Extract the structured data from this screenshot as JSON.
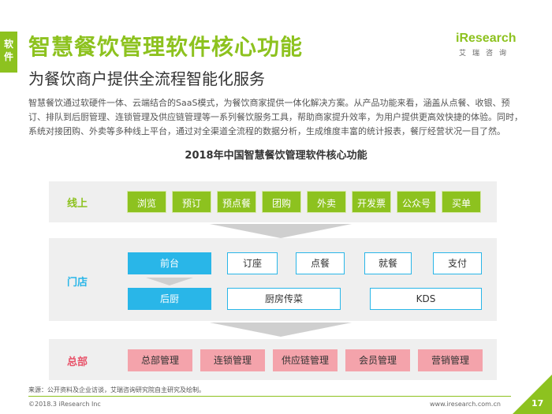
{
  "side_tab": [
    "软",
    "件"
  ],
  "title": "智慧餐饮管理软件核心功能",
  "subtitle": "为餐饮商户提供全流程智能化服务",
  "logo": {
    "word": "iResearch",
    "cn": "艾瑞咨询"
  },
  "intro": "智慧餐饮通过软硬件一体、云端结合的SaaS模式，为餐饮商家提供一体化解决方案。从产品功能来看，涵盖从点餐、收银、预订、排队到后厨管理、连锁管理及供应链管理等一系列餐饮服务工具，帮助商家提升效率，为用户提供更高效快捷的体验。同时，系统对接团购、外卖等多种线上平台，通过对全渠道全流程的数据分析，生成维度丰富的统计报表，餐厅经营状况一目了然。",
  "diagram": {
    "title": "2018年中国智慧餐饮管理软件核心功能",
    "online": {
      "label": "线上",
      "items": [
        "浏览",
        "预订",
        "预点餐",
        "团购",
        "外卖",
        "开发票",
        "公众号",
        "买单"
      ]
    },
    "store": {
      "label": "门店",
      "front": "前台",
      "front_items": [
        "订座",
        "点餐",
        "就餐",
        "支付"
      ],
      "back": "后厨",
      "back_items": [
        "厨房传菜",
        "KDS"
      ]
    },
    "hq": {
      "label": "总部",
      "items": [
        "总部管理",
        "连锁管理",
        "供应链管理",
        "会员管理",
        "营销管理"
      ]
    }
  },
  "source": "来源：公开资料及企业访谈，艾瑞咨询研究院自主研究及绘制。",
  "copyright": "©2018.3 iResearch Inc",
  "site": "www.iresearch.com.cn",
  "page_number": "17",
  "colors": {
    "brand_green": "#8dc21f",
    "store_blue": "#29b6e8",
    "hq_pink": "#f4a3ab",
    "online_label": "#8dc21f",
    "store_label": "#29b6e8",
    "hq_label": "#e8536a"
  }
}
